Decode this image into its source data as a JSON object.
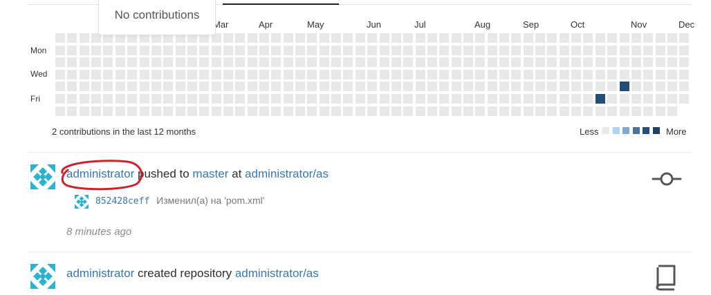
{
  "tooltip": {
    "text": "No contributions"
  },
  "calendar": {
    "months": [
      "Mar",
      "Apr",
      "May",
      "Jun",
      "Jul",
      "Aug",
      "Sep",
      "Oct",
      "Nov",
      "Dec"
    ],
    "day_labels": [
      "Mon",
      "Wed",
      "Fri"
    ],
    "summary": "2 contributions in the last 12 months",
    "legend_less": "Less",
    "legend_more": "More",
    "legend_colors": [
      "#e8e8e8",
      "#acd5f2",
      "#7fa8d1",
      "#49729b",
      "#254e77",
      "#1e3f66"
    ],
    "empty_color": "#e8e8e8",
    "contributions": [
      {
        "week": 45,
        "day": "Fri",
        "count": 1,
        "color": "#254e77"
      },
      {
        "week": 47,
        "day": "Thu",
        "count": 1,
        "color": "#254e77"
      }
    ]
  },
  "events": [
    {
      "author": "administrator",
      "action": "pushed to",
      "branch": "master",
      "preposition": "at",
      "project": "administrator/as",
      "commit": {
        "sha": "852428ceff",
        "message": "Изменил(а) на 'pom.xml'"
      },
      "time": "8 minutes ago",
      "icon": "commit-icon"
    },
    {
      "author": "administrator",
      "action": "created repository",
      "project": "administrator/as",
      "icon": "repository-icon"
    }
  ],
  "colors": {
    "link": "#3777b0",
    "annotation": "#d0202a",
    "avatar": "#2ab3d0"
  }
}
